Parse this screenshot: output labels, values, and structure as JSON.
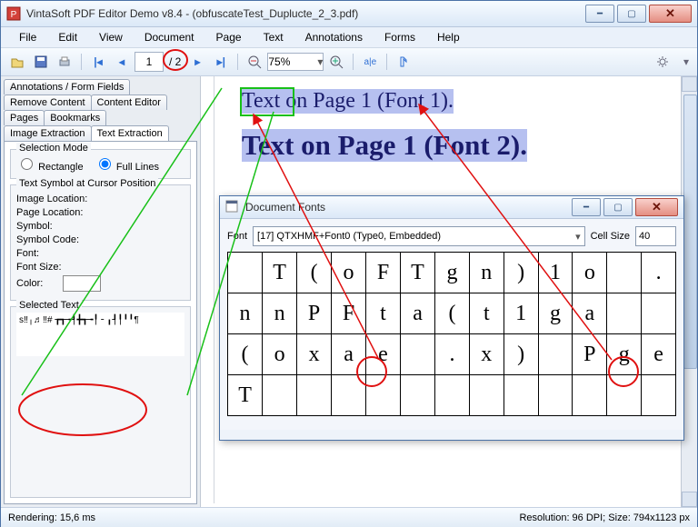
{
  "window": {
    "title": "VintaSoft PDF Editor Demo v8.4  -  (obfuscateTest_Duplucte_2_3.pdf)"
  },
  "menu": {
    "file": "File",
    "edit": "Edit",
    "view": "View",
    "document": "Document",
    "page": "Page",
    "text": "Text",
    "annotations": "Annotations",
    "forms": "Forms",
    "help": "Help"
  },
  "toolbar": {
    "page_current": "1",
    "page_total": "/ 2",
    "zoom": "75%"
  },
  "side": {
    "tabs": {
      "annotations_form": "Annotations / Form Fields",
      "remove_content": "Remove Content",
      "content_editor": "Content Editor",
      "pages": "Pages",
      "bookmarks": "Bookmarks",
      "image_extraction": "Image Extraction",
      "text_extraction": "Text Extraction"
    },
    "selection_mode": {
      "label": "Selection Mode",
      "rectangle": "Rectangle",
      "full_lines": "Full Lines"
    },
    "cursor": {
      "heading": "Text Symbol at Cursor Position",
      "image_location": "Image Location:",
      "page_location": "Page Location:",
      "symbol": "Symbol:",
      "symbol_code": "Symbol Code:",
      "font": "Font:",
      "font_size": "Font Size:",
      "color": "Color:"
    },
    "selected_text": {
      "label": "Selected Text",
      "value": "s‼╷♬‼#\n    ┲┱╼┦╋┱╼╿ ╴╻┦╿╹╹¶"
    }
  },
  "doc": {
    "line1": "Text on Page 1 (Font 1).",
    "line2": "Text on Page 1 (Font 2)."
  },
  "fonts_window": {
    "title": "Document Fonts",
    "font_label": "Font",
    "font_value": "[17] QTXHMF+Font0 (Type0, Embedded)",
    "cell_label": "Cell Size",
    "cell_value": "40",
    "glyphs": [
      [
        "",
        "T",
        "(",
        "o",
        "F",
        "T",
        "g",
        "n",
        ")",
        "1",
        "o",
        "",
        "."
      ],
      [
        "n",
        "n",
        "P",
        "F",
        "t",
        "a",
        "(",
        "t",
        "1",
        "g",
        "a",
        "",
        "",
        ")"
      ],
      [
        "(",
        "o",
        "x",
        "a",
        "e",
        "",
        ".",
        "x",
        ")",
        "",
        "P",
        "g",
        "e",
        ""
      ],
      [
        "T",
        "",
        "",
        "",
        "",
        "",
        "",
        "",
        "",
        "",
        "",
        "",
        "",
        ""
      ]
    ]
  },
  "status": {
    "left": "Rendering: 15,6 ms",
    "right": "Resolution: 96 DPI; Size: 794x1123 px"
  }
}
